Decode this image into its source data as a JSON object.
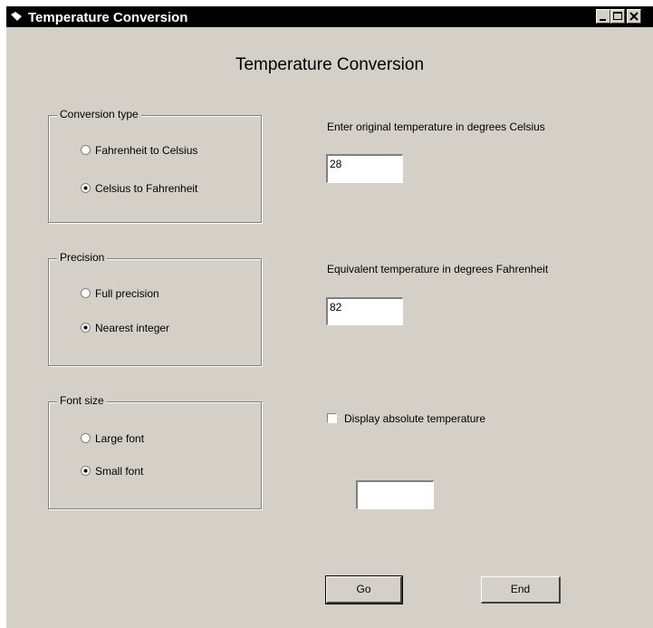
{
  "window": {
    "title": "Temperature Conversion",
    "controls": {
      "minimize": "minimize-icon",
      "maximize": "maximize-icon",
      "close": "close-icon"
    }
  },
  "heading": "Temperature Conversion",
  "conversion_type": {
    "label": "Conversion type",
    "options": [
      {
        "label": "Fahrenheit to Celsius",
        "selected": false
      },
      {
        "label": "Celsius to Fahrenheit",
        "selected": true
      }
    ]
  },
  "precision": {
    "label": "Precision",
    "options": [
      {
        "label": "Full precision",
        "selected": false
      },
      {
        "label": "Nearest integer",
        "selected": true
      }
    ]
  },
  "font_size": {
    "label": "Font size",
    "options": [
      {
        "label": "Large font",
        "selected": false
      },
      {
        "label": "Small font",
        "selected": true
      }
    ]
  },
  "input": {
    "label": "Enter original temperature in degrees Celsius",
    "value": "28"
  },
  "output": {
    "label": "Equivalent temperature in degrees Fahrenheit",
    "value": "82"
  },
  "absolute": {
    "label": "Display absolute temperature",
    "checked": false,
    "value": ""
  },
  "buttons": {
    "go": "Go",
    "end": "End"
  }
}
